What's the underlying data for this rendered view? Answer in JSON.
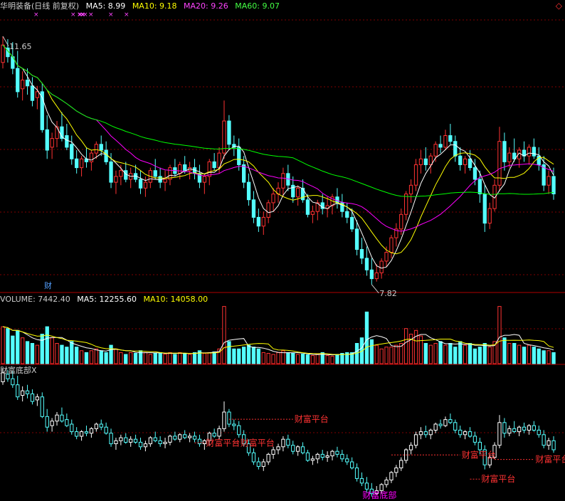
{
  "header": {
    "stock_name": "华明装备(日线 前复权)",
    "ma5": "MA5: 8.99",
    "ma10": "MA10: 9.18",
    "ma20": "MA20: 9.26",
    "ma60": "MA60: 9.07"
  },
  "volume_header": {
    "title": "VOLUME: 7442.40",
    "ma5": "MA5: 12255.60",
    "ma10": "MA10: 14058.00"
  },
  "indicator_header": {
    "title": "财富底部X"
  },
  "colors": {
    "up": "#ff3232",
    "down": "#54ffff",
    "ma5": "#ffffff",
    "ma10": "#ffff00",
    "ma20": "#ff00ff",
    "ma60": "#00ff00",
    "grid": "#800000",
    "divider": "#b00000",
    "signal": "#ff3232",
    "bottom": "#ff00ff"
  },
  "icons": {
    "corner": "diamond-icon"
  },
  "chart_data": {
    "type": "candlestick",
    "title": "华明装备(日线 前复权)",
    "ylim": [
      7.3,
      12.1
    ],
    "high_label": "11.65",
    "low_label": "7.82",
    "finance_marker": "财",
    "top_markers": "×",
    "candles": [
      [
        11.2,
        11.65,
        11.1,
        11.5
      ],
      [
        11.45,
        11.6,
        11.2,
        11.3
      ],
      [
        11.3,
        11.55,
        11.0,
        11.1
      ],
      [
        11.1,
        11.4,
        10.6,
        10.7
      ],
      [
        10.75,
        11.05,
        10.55,
        10.9
      ],
      [
        10.9,
        11.1,
        10.65,
        10.8
      ],
      [
        10.8,
        10.95,
        10.45,
        10.55
      ],
      [
        10.6,
        10.8,
        10.4,
        10.7
      ],
      [
        10.7,
        10.85,
        10.0,
        10.05
      ],
      [
        10.05,
        10.3,
        9.55,
        9.7
      ],
      [
        9.75,
        10.0,
        9.55,
        9.9
      ],
      [
        9.9,
        10.2,
        9.75,
        10.1
      ],
      [
        10.1,
        10.35,
        9.85,
        9.9
      ],
      [
        9.95,
        10.15,
        9.7,
        9.75
      ],
      [
        9.8,
        9.95,
        9.45,
        9.55
      ],
      [
        9.55,
        9.7,
        9.3,
        9.4
      ],
      [
        9.4,
        9.6,
        9.25,
        9.55
      ],
      [
        9.55,
        9.75,
        9.4,
        9.5
      ],
      [
        9.5,
        9.7,
        9.35,
        9.65
      ],
      [
        9.65,
        9.85,
        9.55,
        9.8
      ],
      [
        9.8,
        9.95,
        9.6,
        9.7
      ],
      [
        9.7,
        9.85,
        9.45,
        9.5
      ],
      [
        9.5,
        9.65,
        9.05,
        9.15
      ],
      [
        9.15,
        9.35,
        8.95,
        9.25
      ],
      [
        9.25,
        9.45,
        9.1,
        9.35
      ],
      [
        9.35,
        9.5,
        9.15,
        9.2
      ],
      [
        9.2,
        9.4,
        9.05,
        9.3
      ],
      [
        9.3,
        9.45,
        9.15,
        9.2
      ],
      [
        9.2,
        9.35,
        8.95,
        9.05
      ],
      [
        9.05,
        9.25,
        8.9,
        9.15
      ],
      [
        9.15,
        9.4,
        9.05,
        9.35
      ],
      [
        9.35,
        9.55,
        9.2,
        9.25
      ],
      [
        9.25,
        9.4,
        9.05,
        9.15
      ],
      [
        9.15,
        9.35,
        9.0,
        9.2
      ],
      [
        9.2,
        9.45,
        9.1,
        9.4
      ],
      [
        9.4,
        9.55,
        9.25,
        9.3
      ],
      [
        9.3,
        9.5,
        9.2,
        9.45
      ],
      [
        9.45,
        9.6,
        9.3,
        9.35
      ],
      [
        9.35,
        9.5,
        9.2,
        9.4
      ],
      [
        9.4,
        9.55,
        9.2,
        9.3
      ],
      [
        9.3,
        9.45,
        9.05,
        9.15
      ],
      [
        9.15,
        9.3,
        8.95,
        9.25
      ],
      [
        9.25,
        9.55,
        9.1,
        9.5
      ],
      [
        9.5,
        9.65,
        9.35,
        9.4
      ],
      [
        9.4,
        9.75,
        9.3,
        9.65
      ],
      [
        9.65,
        10.55,
        9.55,
        10.2
      ],
      [
        10.2,
        10.3,
        9.7,
        9.8
      ],
      [
        9.8,
        9.95,
        9.6,
        9.75
      ],
      [
        9.75,
        9.9,
        9.35,
        9.45
      ],
      [
        9.45,
        9.6,
        9.05,
        9.15
      ],
      [
        9.15,
        9.3,
        8.75,
        8.85
      ],
      [
        8.85,
        9.0,
        8.45,
        8.55
      ],
      [
        8.55,
        8.7,
        8.3,
        8.4
      ],
      [
        8.4,
        8.65,
        8.25,
        8.55
      ],
      [
        8.55,
        8.85,
        8.45,
        8.8
      ],
      [
        8.8,
        9.05,
        8.65,
        8.95
      ],
      [
        8.95,
        9.15,
        8.8,
        9.05
      ],
      [
        9.05,
        9.4,
        8.9,
        9.3
      ],
      [
        9.3,
        9.45,
        9.0,
        9.1
      ],
      [
        9.1,
        9.25,
        8.8,
        8.9
      ],
      [
        8.9,
        9.1,
        8.75,
        9.05
      ],
      [
        9.05,
        9.2,
        8.8,
        8.85
      ],
      [
        8.85,
        8.95,
        8.55,
        8.6
      ],
      [
        8.6,
        8.75,
        8.45,
        8.65
      ],
      [
        8.65,
        8.85,
        8.5,
        8.8
      ],
      [
        8.8,
        8.95,
        8.6,
        8.7
      ],
      [
        8.7,
        8.9,
        8.55,
        8.75
      ],
      [
        8.75,
        8.95,
        8.6,
        8.9
      ],
      [
        8.9,
        9.05,
        8.7,
        8.8
      ],
      [
        8.8,
        8.95,
        8.55,
        8.65
      ],
      [
        8.65,
        8.8,
        8.45,
        8.55
      ],
      [
        8.55,
        8.7,
        8.3,
        8.35
      ],
      [
        8.35,
        8.5,
        7.9,
        8.0
      ],
      [
        8.0,
        8.2,
        7.75,
        7.85
      ],
      [
        7.85,
        8.05,
        7.55,
        7.65
      ],
      [
        7.65,
        7.85,
        7.4,
        7.5
      ],
      [
        7.5,
        7.75,
        7.45,
        7.6
      ],
      [
        7.6,
        7.85,
        7.5,
        7.8
      ],
      [
        7.8,
        8.05,
        7.7,
        7.95
      ],
      [
        7.95,
        8.25,
        7.85,
        8.2
      ],
      [
        8.2,
        8.45,
        8.05,
        8.35
      ],
      [
        8.35,
        8.7,
        8.25,
        8.6
      ],
      [
        8.6,
        9.0,
        8.5,
        8.95
      ],
      [
        8.95,
        9.2,
        8.8,
        9.1
      ],
      [
        9.1,
        9.55,
        9.0,
        9.45
      ],
      [
        9.45,
        9.7,
        9.3,
        9.55
      ],
      [
        9.55,
        9.75,
        9.35,
        9.45
      ],
      [
        9.45,
        9.65,
        9.3,
        9.6
      ],
      [
        9.6,
        9.85,
        9.5,
        9.8
      ],
      [
        9.8,
        9.95,
        9.65,
        9.75
      ],
      [
        9.75,
        10.05,
        9.7,
        9.95
      ],
      [
        9.95,
        10.15,
        9.8,
        9.85
      ],
      [
        9.85,
        9.95,
        9.5,
        9.6
      ],
      [
        9.6,
        9.75,
        9.35,
        9.45
      ],
      [
        9.45,
        9.6,
        9.3,
        9.55
      ],
      [
        9.55,
        9.7,
        9.35,
        9.4
      ],
      [
        9.4,
        9.55,
        9.1,
        9.2
      ],
      [
        9.2,
        9.35,
        8.8,
        8.95
      ],
      [
        8.95,
        9.1,
        8.3,
        8.45
      ],
      [
        8.45,
        8.8,
        8.35,
        8.7
      ],
      [
        8.7,
        9.2,
        8.65,
        9.1
      ],
      [
        9.1,
        10.1,
        9.0,
        9.85
      ],
      [
        9.85,
        10.0,
        9.35,
        9.5
      ],
      [
        9.5,
        9.75,
        9.4,
        9.65
      ],
      [
        9.65,
        9.9,
        9.5,
        9.55
      ],
      [
        9.55,
        9.75,
        9.4,
        9.7
      ],
      [
        9.7,
        9.85,
        9.5,
        9.6
      ],
      [
        9.6,
        9.8,
        9.45,
        9.75
      ],
      [
        9.75,
        9.9,
        9.55,
        9.6
      ],
      [
        9.6,
        9.75,
        9.35,
        9.45
      ],
      [
        9.45,
        9.6,
        9.0,
        9.1
      ],
      [
        9.1,
        9.35,
        8.95,
        9.25
      ],
      [
        9.25,
        9.4,
        8.85,
        8.95
      ]
    ],
    "volume": {
      "title": "VOLUME",
      "values": [
        1.0,
        0.95,
        0.75,
        0.9,
        0.7,
        0.6,
        0.55,
        0.5,
        0.8,
        1.0,
        0.7,
        0.55,
        0.5,
        0.45,
        0.6,
        0.45,
        0.35,
        0.3,
        0.35,
        0.4,
        0.35,
        0.3,
        0.5,
        0.4,
        0.3,
        0.25,
        0.3,
        0.28,
        0.35,
        0.3,
        0.25,
        0.28,
        0.3,
        0.26,
        0.3,
        0.25,
        0.3,
        0.28,
        0.25,
        0.3,
        0.35,
        0.28,
        0.3,
        0.32,
        0.4,
        1.55,
        0.6,
        0.4,
        0.4,
        0.45,
        0.5,
        0.45,
        0.4,
        0.3,
        0.28,
        0.25,
        0.3,
        0.35,
        0.3,
        0.28,
        0.25,
        0.26,
        0.24,
        0.22,
        0.25,
        0.3,
        0.22,
        0.2,
        0.25,
        0.28,
        0.3,
        0.3,
        0.55,
        0.7,
        1.4,
        0.65,
        0.5,
        0.4,
        0.45,
        0.45,
        0.5,
        0.55,
        0.95,
        0.8,
        0.9,
        0.75,
        0.55,
        0.5,
        0.55,
        0.6,
        0.5,
        0.55,
        0.45,
        0.6,
        0.5,
        0.55,
        0.4,
        0.45,
        0.55,
        0.45,
        0.6,
        1.55,
        0.7,
        0.55,
        0.55,
        0.5,
        0.45,
        0.5,
        0.45,
        0.4,
        0.35,
        0.35,
        0.3
      ]
    },
    "indicator": {
      "title": "财富底部X",
      "ylim": [
        7.35,
        11.4
      ],
      "signals": [
        {
          "label": "财富平台",
          "price": 9.96,
          "from": 46,
          "to": 59
        },
        {
          "label": "财富平台",
          "price": 9.18,
          "from": 39,
          "to": 41
        },
        {
          "label": "财富平台",
          "price": 9.18,
          "from": 47,
          "to": 48
        },
        {
          "label": "财富平台",
          "price": 8.78,
          "from": 79,
          "to": 93
        },
        {
          "label": "财富平台",
          "price": 8.63,
          "from": 100,
          "to": 108
        },
        {
          "label": "财富平台",
          "price": 8.78,
          "from": 125,
          "to": 127
        },
        {
          "label": "财富平台",
          "price": 7.98,
          "from": 95,
          "to": 97
        }
      ],
      "bottom_label": "财富底部"
    }
  }
}
